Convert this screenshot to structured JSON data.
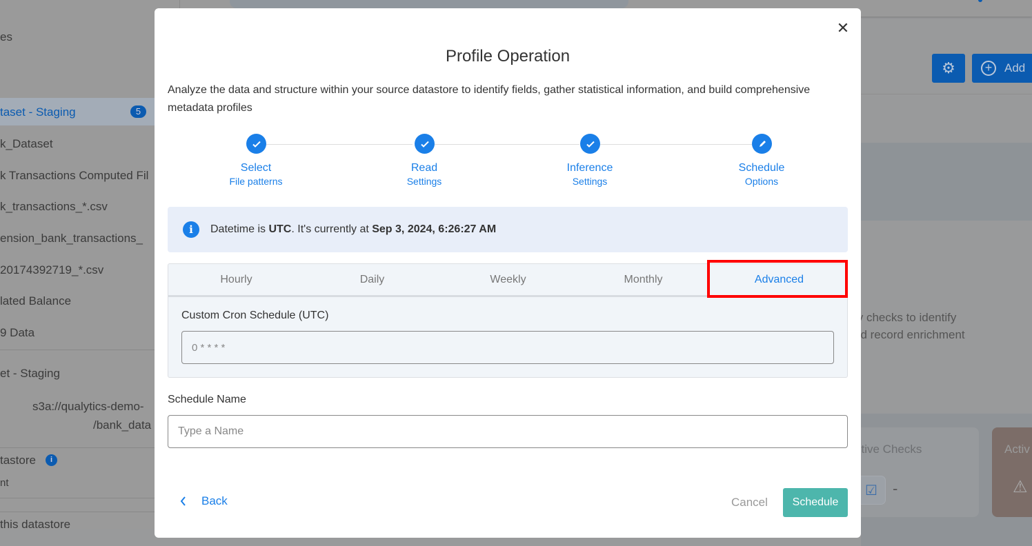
{
  "background": {
    "sidebar": {
      "items": [
        "es",
        "taset - Staging",
        "k_Dataset",
        "k Transactions Computed Fil",
        "k_transactions_*.csv",
        "ension_bank_transactions_",
        "20174392719_*.csv",
        "lated Balance",
        "9 Data",
        "et - Staging",
        "s3a://qualytics-demo-",
        "/bank_data",
        "tastore",
        "nt",
        "this datastore"
      ],
      "selected_badge": "5"
    },
    "header_buttons": {
      "settings_icon": "gear-icon",
      "add_label": "Add",
      "add_icon": "plus-circle-icon"
    },
    "description_fragment": [
      "ty checks to identify",
      "nd record enrichment"
    ],
    "cards": [
      "ctive Checks",
      "Activ"
    ],
    "card_value": "-"
  },
  "modal": {
    "title": "Profile Operation",
    "description": "Analyze the data and structure within your source datastore to identify fields, gather statistical information, and build comprehensive metadata profiles",
    "steps": [
      {
        "title": "Select",
        "subtitle": "File patterns",
        "icon": "check-icon"
      },
      {
        "title": "Read",
        "subtitle": "Settings",
        "icon": "check-icon"
      },
      {
        "title": "Inference",
        "subtitle": "Settings",
        "icon": "check-icon"
      },
      {
        "title": "Schedule",
        "subtitle": "Options",
        "icon": "pencil-icon"
      }
    ],
    "info": {
      "prefix": "Datetime is ",
      "tz": "UTC",
      "middle": ". It's currently at ",
      "datetime": "Sep 3, 2024, 6:26:27 AM"
    },
    "tabs": [
      "Hourly",
      "Daily",
      "Weekly",
      "Monthly",
      "Advanced"
    ],
    "active_tab": "Advanced",
    "cron": {
      "label": "Custom Cron Schedule (UTC)",
      "placeholder": "0 * * * *"
    },
    "schedule_name": {
      "label": "Schedule Name",
      "placeholder": "Type a Name"
    },
    "footer": {
      "back": "Back",
      "cancel": "Cancel",
      "submit": "Schedule"
    }
  },
  "colors": {
    "primary": "#1a7fe8",
    "submit": "#4db6ac",
    "highlight": "#ff0000"
  }
}
